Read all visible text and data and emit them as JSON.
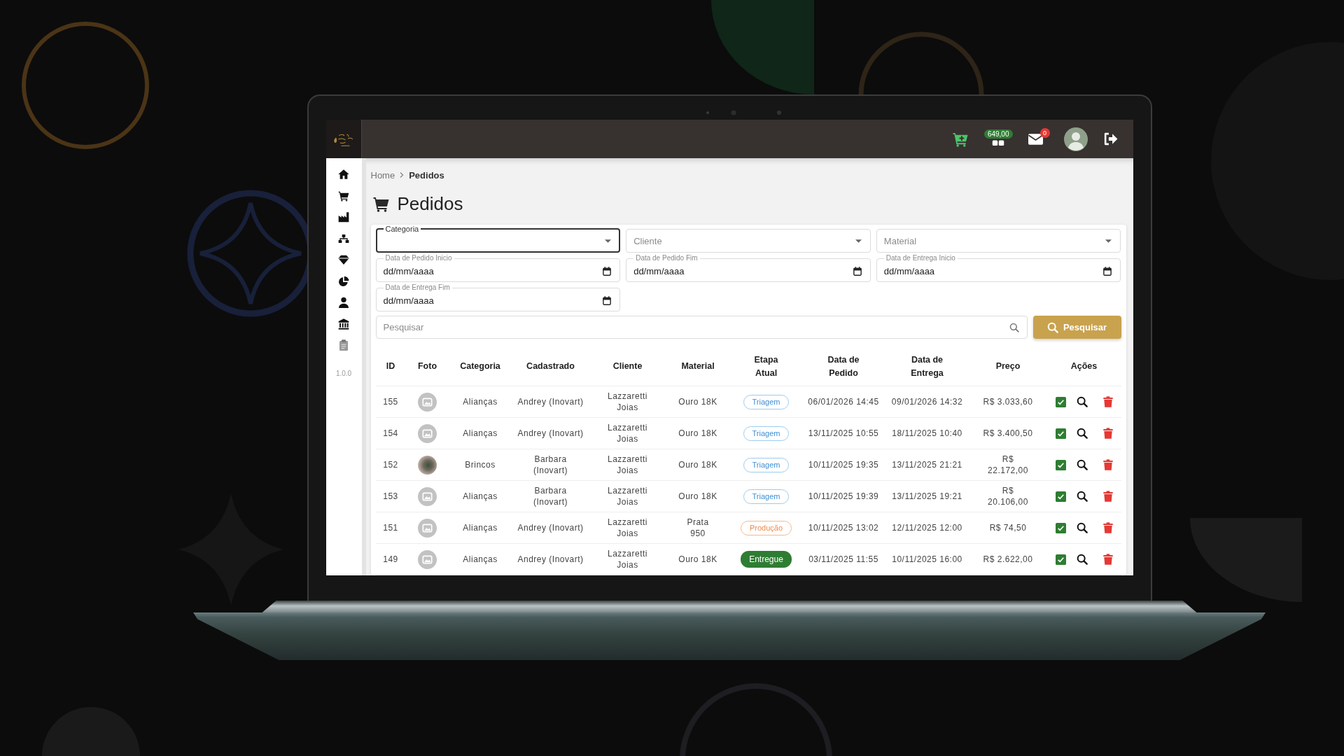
{
  "top_bar": {
    "balance_badge": "649,00",
    "messages_badge": "0"
  },
  "sidebar": {
    "version": "1.0.0"
  },
  "breadcrumb": [
    "Home",
    "Pedidos"
  ],
  "page_title": "Pedidos",
  "filters": [
    {
      "kind": "select",
      "label": "Categoria",
      "focused": true
    },
    {
      "kind": "select",
      "label": "Cliente",
      "focused": false
    },
    {
      "kind": "select",
      "label": "Material",
      "focused": false
    },
    {
      "kind": "date",
      "label": "Data de Pedido Inicio",
      "placeholder": "dd/mm/aaaa"
    },
    {
      "kind": "date",
      "label": "Data de Pedido Fim",
      "placeholder": "dd/mm/aaaa"
    },
    {
      "kind": "date",
      "label": "Data de Entrega Inicio",
      "placeholder": "dd/mm/aaaa"
    },
    {
      "kind": "date",
      "label": "Data de Entrega Fim",
      "placeholder": "dd/mm/aaaa"
    }
  ],
  "search": {
    "placeholder": "Pesquisar",
    "button": "Pesquisar"
  },
  "table": {
    "columns": [
      "ID",
      "Foto",
      "Categoria",
      "Cadastrado",
      "Cliente",
      "Material",
      "Etapa Atual",
      "Data de Pedido",
      "Data de Entrega",
      "Preço",
      "Ações"
    ],
    "rows": [
      {
        "id": "155",
        "photo": {
          "kind": "placeholder"
        },
        "category": "Alianças",
        "registered_by": "Andrey (Inovart)",
        "client": "Lazzaretti Joias",
        "material": "Ouro 18K",
        "stage": {
          "label": "Triagem",
          "kind": "triage"
        },
        "order_date": "06/01/2026 14:45",
        "delivery_date": "09/01/2026 14:32",
        "price": "R$ 3.033,60"
      },
      {
        "id": "154",
        "photo": {
          "kind": "placeholder"
        },
        "category": "Alianças",
        "registered_by": "Andrey (Inovart)",
        "client": "Lazzaretti Joias",
        "material": "Ouro 18K",
        "stage": {
          "label": "Triagem",
          "kind": "triage"
        },
        "order_date": "13/11/2025 10:55",
        "delivery_date": "18/11/2025 10:40",
        "price": "R$ 3.400,50"
      },
      {
        "id": "152",
        "photo": {
          "kind": "image"
        },
        "category": "Brincos",
        "registered_by": "Barbara (Inovart)",
        "client": "Lazzaretti Joias",
        "material": "Ouro 18K",
        "stage": {
          "label": "Triagem",
          "kind": "triage"
        },
        "order_date": "10/11/2025 19:35",
        "delivery_date": "13/11/2025 21:21",
        "price": "R$ 22.172,00"
      },
      {
        "id": "153",
        "photo": {
          "kind": "placeholder"
        },
        "category": "Alianças",
        "registered_by": "Barbara (Inovart)",
        "client": "Lazzaretti Joias",
        "material": "Ouro 18K",
        "stage": {
          "label": "Triagem",
          "kind": "triage"
        },
        "order_date": "10/11/2025 19:39",
        "delivery_date": "13/11/2025 19:21",
        "price": "R$ 20.106,00"
      },
      {
        "id": "151",
        "photo": {
          "kind": "placeholder"
        },
        "category": "Alianças",
        "registered_by": "Andrey (Inovart)",
        "client": "Lazzaretti Joias",
        "material": "Prata 950",
        "stage": {
          "label": "Produção",
          "kind": "production"
        },
        "order_date": "10/11/2025 13:02",
        "delivery_date": "12/11/2025 12:00",
        "price": "R$ 74,50"
      },
      {
        "id": "149",
        "photo": {
          "kind": "placeholder"
        },
        "category": "Alianças",
        "registered_by": "Andrey (Inovart)",
        "client": "Lazzaretti Joias",
        "material": "Ouro 18K",
        "stage": {
          "label": "Entregue",
          "kind": "delivered"
        },
        "order_date": "03/11/2025 11:55",
        "delivery_date": "10/11/2025 16:00",
        "price": "R$ 2.622,00"
      }
    ]
  }
}
